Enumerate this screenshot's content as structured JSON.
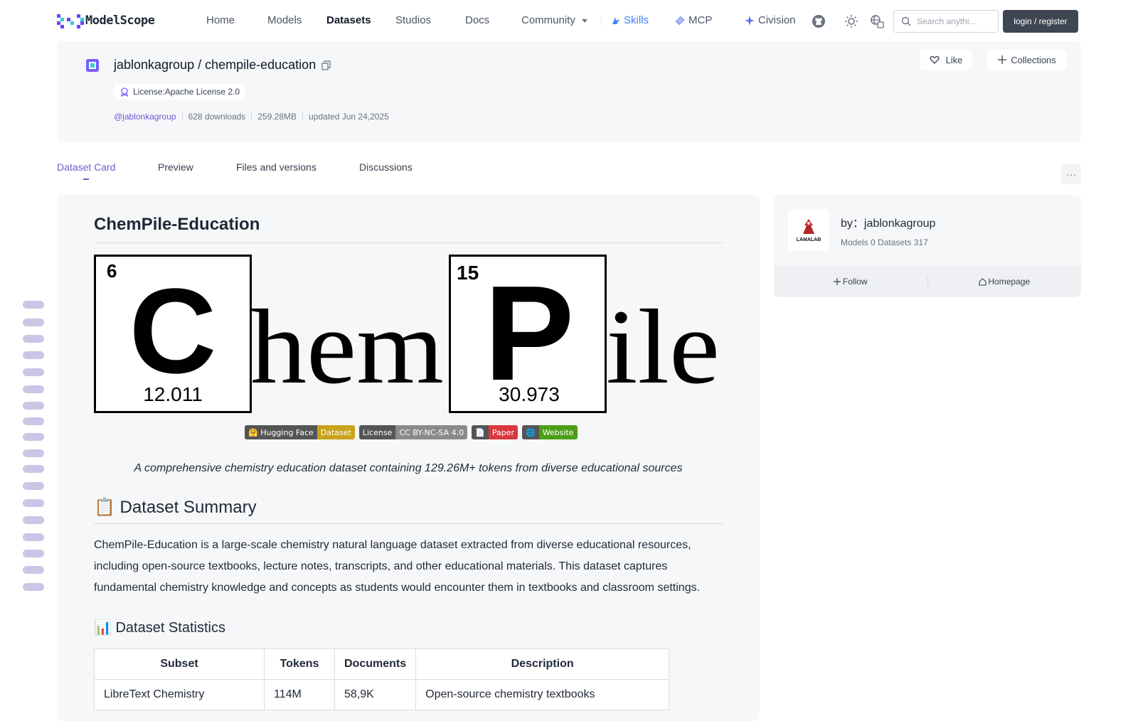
{
  "nav": {
    "logo_text": "ModelScope",
    "links": [
      "Home",
      "Models",
      "Datasets",
      "Studios",
      "Docs",
      "Community"
    ],
    "skills": "Skills",
    "mcp": "MCP",
    "civision": "Civision",
    "search_placeholder": "Search anythi...",
    "login": "login / register"
  },
  "dataset": {
    "owner": "jablonkagroup",
    "slash": "/",
    "name": "chempile-education",
    "license": "License:Apache License 2.0",
    "owner_handle": "@jablonkagroup",
    "downloads": "628 downloads",
    "size": "259.28MB",
    "updated": "updated Jun 24,2025",
    "like": "Like",
    "collections": "Collections"
  },
  "tabs": [
    "Dataset Card",
    "Preview",
    "Files and versions",
    "Discussions"
  ],
  "more": "···",
  "card": {
    "title": "ChemPile-Education",
    "banner": {
      "c_number": "6",
      "c_symbol": "C",
      "c_mass": "12.011",
      "mid_text": "hem",
      "p_number": "15",
      "p_symbol": "P",
      "p_mass": "30.973",
      "end_text": "ile"
    },
    "badges": [
      {
        "left": "🤗 Hugging Face",
        "right": "Dataset",
        "color": "#c9a31a"
      },
      {
        "left": "License",
        "right": "CC BY-NC-SA 4.0",
        "color": "#8a8a8a"
      },
      {
        "left": "📄",
        "right": "Paper",
        "color": "#d9383c"
      },
      {
        "left": "🌐",
        "right": "Website",
        "color": "#4c9e16"
      }
    ],
    "tagline": "A comprehensive chemistry education dataset containing 129.26M+ tokens from diverse educational sources",
    "summary_heading": "📋 Dataset Summary",
    "summary": "ChemPile-Education is a large-scale chemistry natural language dataset extracted from diverse educational resources, including open-source textbooks, lecture notes, transcripts, and other educational materials. This dataset captures fundamental chemistry knowledge and concepts as students would encounter them in textbooks and classroom settings.",
    "stats_heading": "📊 Dataset Statistics",
    "stats_headers": [
      "Subset",
      "Tokens",
      "Documents",
      "Description"
    ],
    "stats_rows": [
      [
        "LibreText Chemistry",
        "114M",
        "58,9K",
        "Open-source chemistry textbooks"
      ]
    ]
  },
  "org": {
    "logo_text": "LAMALAB",
    "by": "by：jablonkagroup",
    "stats": "Models 0  Datasets 317",
    "follow": "Follow",
    "homepage": "Homepage"
  }
}
